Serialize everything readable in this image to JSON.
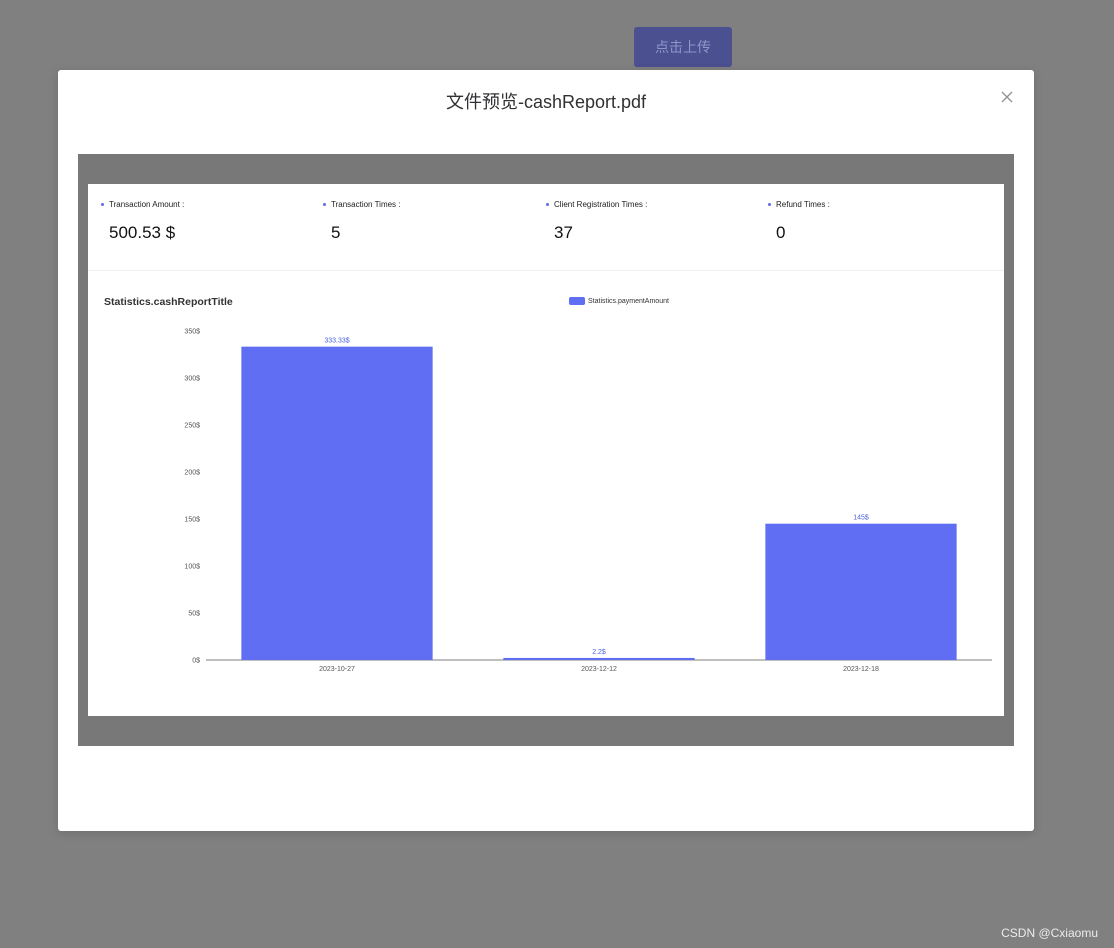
{
  "background_button": {
    "label": "点击上传"
  },
  "modal": {
    "title": "文件预览-cashReport.pdf",
    "close_icon": "close-icon"
  },
  "report": {
    "stats": [
      {
        "label": "Transaction Amount :",
        "value": "500.53 $"
      },
      {
        "label": "Transaction Times :",
        "value": "5"
      },
      {
        "label": "Client Registration Times :",
        "value": "37"
      },
      {
        "label": "Refund Times :",
        "value": "0"
      }
    ]
  },
  "chart_data": {
    "type": "bar",
    "title": "Statistics.cashReportTitle",
    "categories": [
      "2023-10-27",
      "2023-12-12",
      "2023-12-18"
    ],
    "series": [
      {
        "name": "Statistics.paymentAmount",
        "values": [
          333.33,
          2.2,
          145
        ]
      }
    ],
    "data_labels": [
      "333.33$",
      "2.2$",
      "145$"
    ],
    "y_ticks": [
      "0$",
      "50$",
      "100$",
      "150$",
      "200$",
      "250$",
      "300$",
      "350$"
    ],
    "ylim": [
      0,
      350
    ],
    "legend_position": "top-center",
    "colors": {
      "bar": "#5f6ef2",
      "label": "#4a63e0"
    }
  },
  "watermark": "CSDN @Cxiaomu"
}
